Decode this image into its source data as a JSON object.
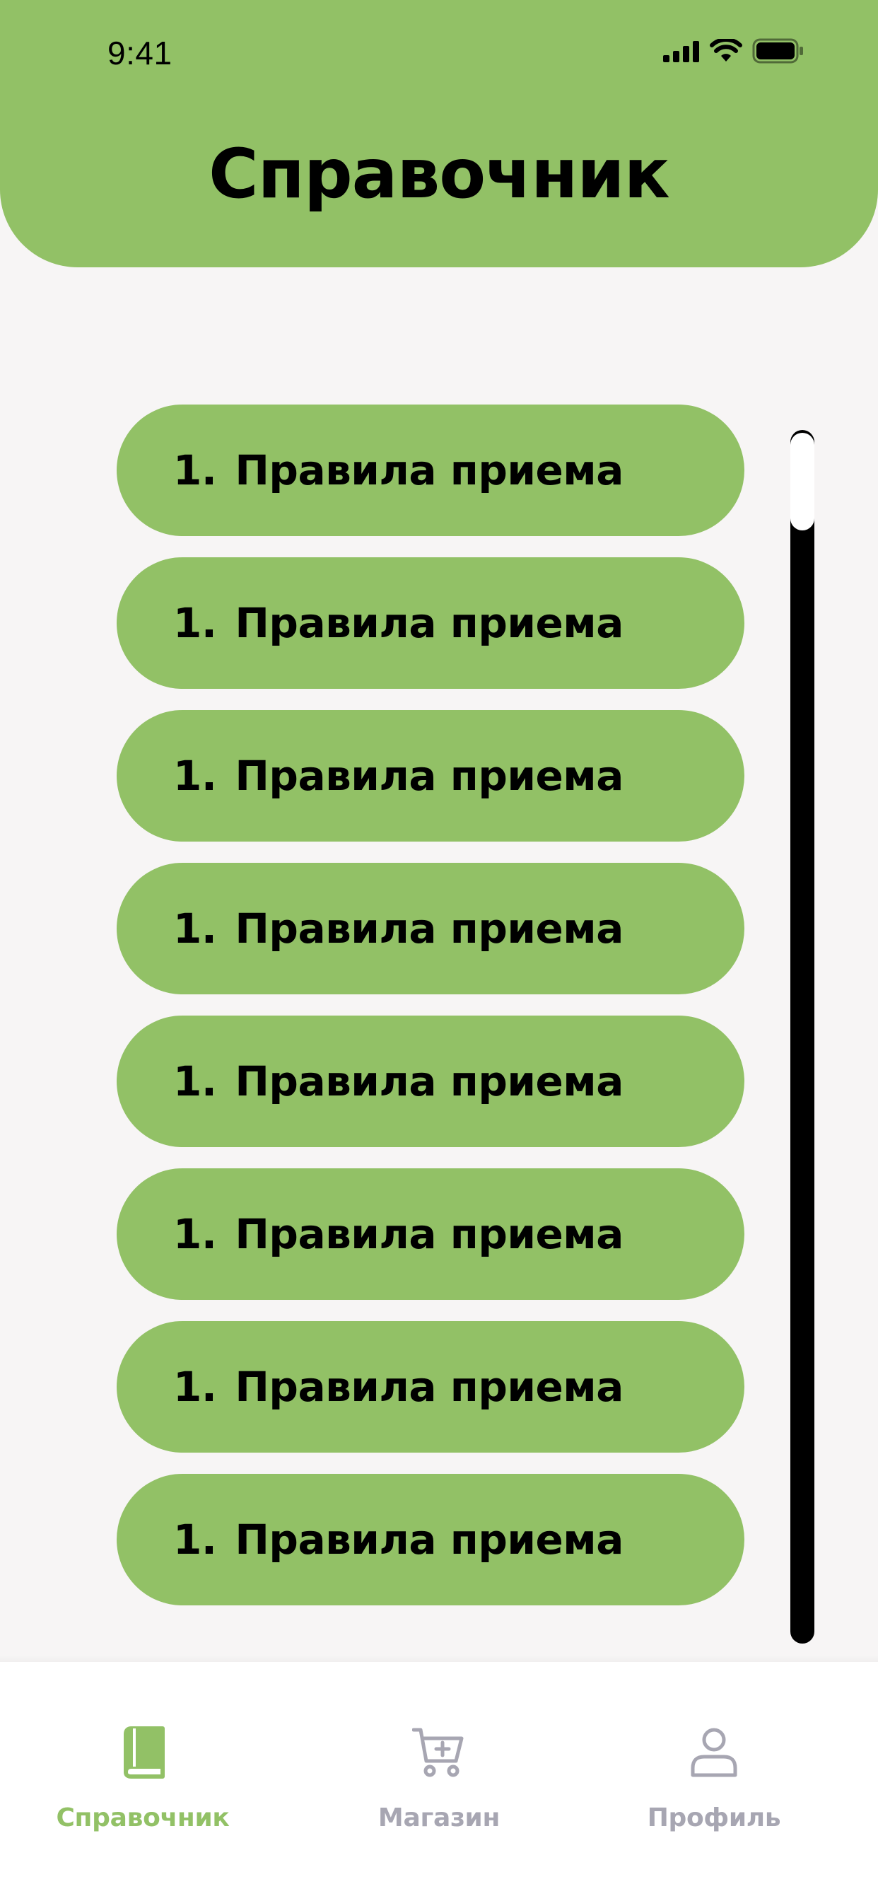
{
  "status_bar": {
    "time": "9:41"
  },
  "header": {
    "title": "Справочник"
  },
  "list": {
    "items": [
      {
        "number": "1.",
        "label": "Правила приема"
      },
      {
        "number": "1.",
        "label": "Правила приема"
      },
      {
        "number": "1.",
        "label": "Правила приема"
      },
      {
        "number": "1.",
        "label": "Правила приема"
      },
      {
        "number": "1.",
        "label": "Правила приема"
      },
      {
        "number": "1.",
        "label": "Правила приема"
      },
      {
        "number": "1.",
        "label": "Правила приема"
      },
      {
        "number": "1.",
        "label": "Правила приема"
      }
    ]
  },
  "tabbar": {
    "tabs": [
      {
        "label": "Справочник",
        "icon": "book-icon",
        "active": true
      },
      {
        "label": "Магазин",
        "icon": "cart-plus-icon",
        "active": false
      },
      {
        "label": "Профиль",
        "icon": "user-icon",
        "active": false
      }
    ]
  },
  "colors": {
    "accent_green": "#92c166",
    "inactive_gray": "#a7a6b2",
    "background": "#f7f5f5"
  }
}
